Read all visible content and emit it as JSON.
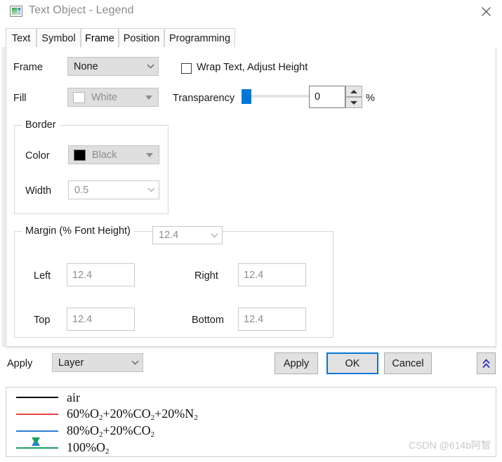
{
  "window": {
    "title": "Text Object - Legend",
    "icon": "image-chart-icon",
    "close_label": "✕"
  },
  "tabs": [
    {
      "label": "Text",
      "active": false
    },
    {
      "label": "Symbol",
      "active": false
    },
    {
      "label": "Frame",
      "active": true
    },
    {
      "label": "Position",
      "active": false
    },
    {
      "label": "Programming",
      "active": false
    }
  ],
  "frame_tab": {
    "frame": {
      "label": "Frame",
      "value": "None"
    },
    "fill": {
      "label": "Fill",
      "value": "White",
      "swatch_color": "#ffffff",
      "disabled": true
    },
    "wrap_text": {
      "label": "Wrap Text, Adjust Height",
      "checked": false
    },
    "transparency": {
      "label": "Transparency",
      "value": "0",
      "unit": "%",
      "slider_percent": 0,
      "accent_color": "#0078d7"
    },
    "border": {
      "group_label": "Border",
      "color_label": "Color",
      "color_value": "Black",
      "color_swatch": "#000000",
      "width_label": "Width",
      "width_value": "0.5"
    },
    "margin": {
      "group_label": "Margin (% Font Height)",
      "preset_value": "12.4",
      "left_label": "Left",
      "left_value": "12.4",
      "right_label": "Right",
      "right_value": "12.4",
      "top_label": "Top",
      "top_value": "12.4",
      "bottom_label": "Bottom",
      "bottom_value": "12.4"
    }
  },
  "bottom_bar": {
    "apply_scope_label": "Apply",
    "apply_scope_value": "Layer",
    "apply_button": "Apply",
    "ok_button": "OK",
    "cancel_button": "Cancel",
    "collapse_icon": "double-chevron-up-icon",
    "focus_color": "#0078d7"
  },
  "legend_preview": {
    "entries": [
      {
        "marker": "square",
        "color": "#000000",
        "marker_color": "#4d4d4d",
        "text_html": "air"
      },
      {
        "marker": "circle",
        "color": "#e8443a",
        "marker_color": "#e8443a",
        "text_html": "60%O<sub>2</sub>+20%CO<sub>2</sub>+20%N<sub>2</sub>"
      },
      {
        "marker": "triangle-up",
        "color": "#2a7fd4",
        "marker_color": "#2a7fd4",
        "text_html": "80%O<sub>2</sub>+20%CO<sub>2</sub>"
      },
      {
        "marker": "triangle-down",
        "color": "#1f9d62",
        "marker_color": "#1f9d62",
        "text_html": "100%O<sub>2</sub>"
      }
    ]
  },
  "watermark": "CSDN @614b阿智"
}
